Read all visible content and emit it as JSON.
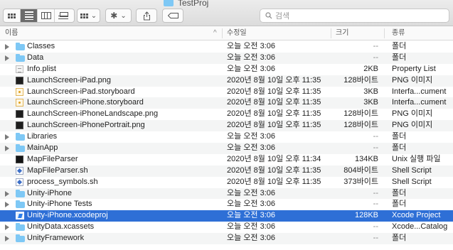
{
  "window": {
    "title": "TestProj"
  },
  "search": {
    "placeholder": "검색"
  },
  "header": {
    "name": "이름",
    "date": "수정일",
    "size": "크기",
    "kind": "종류"
  },
  "rows": [
    {
      "name": "Classes",
      "date": "오늘 오전 3:06",
      "size": "--",
      "kind": "폴더",
      "icon": "folder-icon",
      "disclosure": true
    },
    {
      "name": "Data",
      "date": "오늘 오전 3:06",
      "size": "--",
      "kind": "폴더",
      "icon": "folder-icon",
      "disclosure": true
    },
    {
      "name": "Info.plist",
      "date": "오늘 오전 3:06",
      "size": "2KB",
      "kind": "Property List",
      "icon": "plist-file-icon",
      "disclosure": false
    },
    {
      "name": "LaunchScreen-iPad.png",
      "date": "2020년 8월 10일 오후 11:35",
      "size": "128바이트",
      "kind": "PNG 이미지",
      "icon": "png-image-icon",
      "disclosure": false
    },
    {
      "name": "LaunchScreen-iPad.storyboard",
      "date": "2020년 8월 10일 오후 11:35",
      "size": "3KB",
      "kind": "Interfa...cument",
      "icon": "storyboard-file-icon",
      "disclosure": false
    },
    {
      "name": "LaunchScreen-iPhone.storyboard",
      "date": "2020년 8월 10일 오후 11:35",
      "size": "3KB",
      "kind": "Interfa...cument",
      "icon": "storyboard-file-icon",
      "disclosure": false
    },
    {
      "name": "LaunchScreen-iPhoneLandscape.png",
      "date": "2020년 8월 10일 오후 11:35",
      "size": "128바이트",
      "kind": "PNG 이미지",
      "icon": "png-image-icon",
      "disclosure": false
    },
    {
      "name": "LaunchScreen-iPhonePortrait.png",
      "date": "2020년 8월 10일 오후 11:35",
      "size": "128바이트",
      "kind": "PNG 이미지",
      "icon": "png-image-icon",
      "disclosure": false
    },
    {
      "name": "Libraries",
      "date": "오늘 오전 3:06",
      "size": "--",
      "kind": "폴더",
      "icon": "folder-icon",
      "disclosure": true
    },
    {
      "name": "MainApp",
      "date": "오늘 오전 3:06",
      "size": "--",
      "kind": "폴더",
      "icon": "folder-icon",
      "disclosure": true
    },
    {
      "name": "MapFileParser",
      "date": "2020년 8월 10일 오후 11:34",
      "size": "134KB",
      "kind": "Unix 실행 파일",
      "icon": "unix-executable-icon",
      "disclosure": false
    },
    {
      "name": "MapFileParser.sh",
      "date": "2020년 8월 10일 오후 11:35",
      "size": "804바이트",
      "kind": "Shell Script",
      "icon": "shell-script-icon",
      "disclosure": false
    },
    {
      "name": "process_symbols.sh",
      "date": "2020년 8월 10일 오후 11:35",
      "size": "373바이트",
      "kind": "Shell Script",
      "icon": "shell-script-icon",
      "disclosure": false
    },
    {
      "name": "Unity-iPhone",
      "date": "오늘 오전 3:06",
      "size": "--",
      "kind": "폴더",
      "icon": "folder-icon",
      "disclosure": true
    },
    {
      "name": "Unity-iPhone Tests",
      "date": "오늘 오전 3:06",
      "size": "--",
      "kind": "폴더",
      "icon": "folder-icon",
      "disclosure": true
    },
    {
      "name": "Unity-iPhone.xcodeproj",
      "date": "오늘 오전 3:06",
      "size": "128KB",
      "kind": "Xcode Project",
      "icon": "xcode-project-icon",
      "disclosure": false,
      "selected": true
    },
    {
      "name": "UnityData.xcassets",
      "date": "오늘 오전 3:06",
      "size": "--",
      "kind": "Xcode...Catalog",
      "icon": "folder-icon",
      "disclosure": true
    },
    {
      "name": "UnityFramework",
      "date": "오늘 오전 3:06",
      "size": "--",
      "kind": "폴더",
      "icon": "folder-icon",
      "disclosure": true
    }
  ],
  "colors": {
    "selection": "#2e6fd6",
    "folder": "#7ec8f5",
    "alt_row": "#f4f5f5"
  }
}
